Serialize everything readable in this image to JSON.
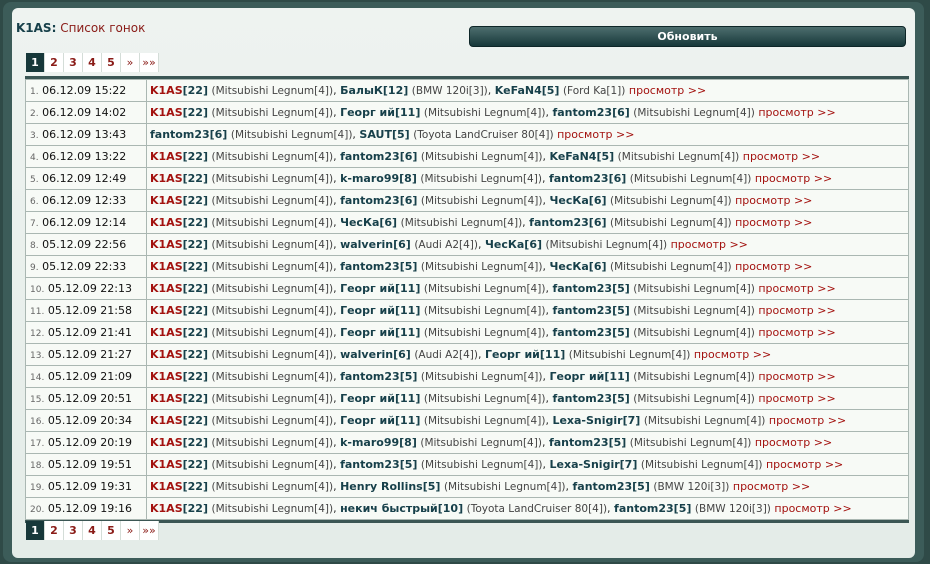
{
  "header": {
    "user": "K1AS",
    "subtitle": "Список гонок",
    "refresh_label": "Обновить"
  },
  "pager": {
    "pages": [
      "1",
      "2",
      "3",
      "4",
      "5"
    ],
    "current": "1",
    "next": "»",
    "last": "»»"
  },
  "races": [
    {
      "n": "1.",
      "date": "06.12.09 15:22",
      "racers": [
        {
          "name": "K1AS",
          "lvl": "[22]",
          "car": "(Mitsubishi Legnum[4])",
          "me": true
        },
        {
          "name": "БалыК",
          "lvl": "[12]",
          "car": "(BMW 120i[3])"
        },
        {
          "name": "KeFaN4",
          "lvl": "[5]",
          "car": "(Ford Ka[1])"
        }
      ]
    },
    {
      "n": "2.",
      "date": "06.12.09 14:02",
      "racers": [
        {
          "name": "K1AS",
          "lvl": "[22]",
          "car": "(Mitsubishi Legnum[4])",
          "me": true
        },
        {
          "name": "Георг ий",
          "lvl": "[11]",
          "car": "(Mitsubishi Legnum[4])"
        },
        {
          "name": "fantom23",
          "lvl": "[6]",
          "car": "(Mitsubishi Legnum[4])"
        }
      ]
    },
    {
      "n": "3.",
      "date": "06.12.09 13:43",
      "racers": [
        {
          "name": "fantom23",
          "lvl": "[6]",
          "car": "(Mitsubishi Legnum[4])"
        },
        {
          "name": "SAUT",
          "lvl": "[5]",
          "car": "(Toyota LandCruiser 80[4])"
        }
      ]
    },
    {
      "n": "4.",
      "date": "06.12.09 13:22",
      "racers": [
        {
          "name": "K1AS",
          "lvl": "[22]",
          "car": "(Mitsubishi Legnum[4])",
          "me": true
        },
        {
          "name": "fantom23",
          "lvl": "[6]",
          "car": "(Mitsubishi Legnum[4])"
        },
        {
          "name": "KeFaN4",
          "lvl": "[5]",
          "car": "(Mitsubishi Legnum[4])"
        }
      ]
    },
    {
      "n": "5.",
      "date": "06.12.09 12:49",
      "racers": [
        {
          "name": "K1AS",
          "lvl": "[22]",
          "car": "(Mitsubishi Legnum[4])",
          "me": true
        },
        {
          "name": "k-maro99",
          "lvl": "[8]",
          "car": "(Mitsubishi Legnum[4])"
        },
        {
          "name": "fantom23",
          "lvl": "[6]",
          "car": "(Mitsubishi Legnum[4])"
        }
      ]
    },
    {
      "n": "6.",
      "date": "06.12.09 12:33",
      "racers": [
        {
          "name": "K1AS",
          "lvl": "[22]",
          "car": "(Mitsubishi Legnum[4])",
          "me": true
        },
        {
          "name": "fantom23",
          "lvl": "[6]",
          "car": "(Mitsubishi Legnum[4])"
        },
        {
          "name": "ЧесКа",
          "lvl": "[6]",
          "car": "(Mitsubishi Legnum[4])"
        }
      ]
    },
    {
      "n": "7.",
      "date": "06.12.09 12:14",
      "racers": [
        {
          "name": "K1AS",
          "lvl": "[22]",
          "car": "(Mitsubishi Legnum[4])",
          "me": true
        },
        {
          "name": "ЧесКа",
          "lvl": "[6]",
          "car": "(Mitsubishi Legnum[4])"
        },
        {
          "name": "fantom23",
          "lvl": "[6]",
          "car": "(Mitsubishi Legnum[4])"
        }
      ]
    },
    {
      "n": "8.",
      "date": "05.12.09 22:56",
      "racers": [
        {
          "name": "K1AS",
          "lvl": "[22]",
          "car": "(Mitsubishi Legnum[4])",
          "me": true
        },
        {
          "name": "walverin",
          "lvl": "[6]",
          "car": "(Audi A2[4])"
        },
        {
          "name": "ЧесКа",
          "lvl": "[6]",
          "car": "(Mitsubishi Legnum[4])"
        }
      ]
    },
    {
      "n": "9.",
      "date": "05.12.09 22:33",
      "racers": [
        {
          "name": "K1AS",
          "lvl": "[22]",
          "car": "(Mitsubishi Legnum[4])",
          "me": true
        },
        {
          "name": "fantom23",
          "lvl": "[5]",
          "car": "(Mitsubishi Legnum[4])"
        },
        {
          "name": "ЧесКа",
          "lvl": "[6]",
          "car": "(Mitsubishi Legnum[4])"
        }
      ]
    },
    {
      "n": "10.",
      "date": "05.12.09 22:13",
      "racers": [
        {
          "name": "K1AS",
          "lvl": "[22]",
          "car": "(Mitsubishi Legnum[4])",
          "me": true
        },
        {
          "name": "Георг ий",
          "lvl": "[11]",
          "car": "(Mitsubishi Legnum[4])"
        },
        {
          "name": "fantom23",
          "lvl": "[5]",
          "car": "(Mitsubishi Legnum[4])"
        }
      ]
    },
    {
      "n": "11.",
      "date": "05.12.09 21:58",
      "racers": [
        {
          "name": "K1AS",
          "lvl": "[22]",
          "car": "(Mitsubishi Legnum[4])",
          "me": true
        },
        {
          "name": "Георг ий",
          "lvl": "[11]",
          "car": "(Mitsubishi Legnum[4])"
        },
        {
          "name": "fantom23",
          "lvl": "[5]",
          "car": "(Mitsubishi Legnum[4])"
        }
      ]
    },
    {
      "n": "12.",
      "date": "05.12.09 21:41",
      "racers": [
        {
          "name": "K1AS",
          "lvl": "[22]",
          "car": "(Mitsubishi Legnum[4])",
          "me": true
        },
        {
          "name": "Георг ий",
          "lvl": "[11]",
          "car": "(Mitsubishi Legnum[4])"
        },
        {
          "name": "fantom23",
          "lvl": "[5]",
          "car": "(Mitsubishi Legnum[4])"
        }
      ]
    },
    {
      "n": "13.",
      "date": "05.12.09 21:27",
      "racers": [
        {
          "name": "K1AS",
          "lvl": "[22]",
          "car": "(Mitsubishi Legnum[4])",
          "me": true
        },
        {
          "name": "walverin",
          "lvl": "[6]",
          "car": "(Audi A2[4])"
        },
        {
          "name": "Георг ий",
          "lvl": "[11]",
          "car": "(Mitsubishi Legnum[4])"
        }
      ]
    },
    {
      "n": "14.",
      "date": "05.12.09 21:09",
      "racers": [
        {
          "name": "K1AS",
          "lvl": "[22]",
          "car": "(Mitsubishi Legnum[4])",
          "me": true
        },
        {
          "name": "fantom23",
          "lvl": "[5]",
          "car": "(Mitsubishi Legnum[4])"
        },
        {
          "name": "Георг ий",
          "lvl": "[11]",
          "car": "(Mitsubishi Legnum[4])"
        }
      ]
    },
    {
      "n": "15.",
      "date": "05.12.09 20:51",
      "racers": [
        {
          "name": "K1AS",
          "lvl": "[22]",
          "car": "(Mitsubishi Legnum[4])",
          "me": true
        },
        {
          "name": "Георг ий",
          "lvl": "[11]",
          "car": "(Mitsubishi Legnum[4])"
        },
        {
          "name": "fantom23",
          "lvl": "[5]",
          "car": "(Mitsubishi Legnum[4])"
        }
      ]
    },
    {
      "n": "16.",
      "date": "05.12.09 20:34",
      "racers": [
        {
          "name": "K1AS",
          "lvl": "[22]",
          "car": "(Mitsubishi Legnum[4])",
          "me": true
        },
        {
          "name": "Георг ий",
          "lvl": "[11]",
          "car": "(Mitsubishi Legnum[4])"
        },
        {
          "name": "Lexa-Snigir",
          "lvl": "[7]",
          "car": "(Mitsubishi Legnum[4])"
        }
      ]
    },
    {
      "n": "17.",
      "date": "05.12.09 20:19",
      "racers": [
        {
          "name": "K1AS",
          "lvl": "[22]",
          "car": "(Mitsubishi Legnum[4])",
          "me": true
        },
        {
          "name": "k-maro99",
          "lvl": "[8]",
          "car": "(Mitsubishi Legnum[4])"
        },
        {
          "name": "fantom23",
          "lvl": "[5]",
          "car": "(Mitsubishi Legnum[4])"
        }
      ]
    },
    {
      "n": "18.",
      "date": "05.12.09 19:51",
      "racers": [
        {
          "name": "K1AS",
          "lvl": "[22]",
          "car": "(Mitsubishi Legnum[4])",
          "me": true
        },
        {
          "name": "fantom23",
          "lvl": "[5]",
          "car": "(Mitsubishi Legnum[4])"
        },
        {
          "name": "Lexa-Snigir",
          "lvl": "[7]",
          "car": "(Mitsubishi Legnum[4])"
        }
      ]
    },
    {
      "n": "19.",
      "date": "05.12.09 19:31",
      "racers": [
        {
          "name": "K1AS",
          "lvl": "[22]",
          "car": "(Mitsubishi Legnum[4])",
          "me": true
        },
        {
          "name": "Henry Rollins",
          "lvl": "[5]",
          "car": "(Mitsubishi Legnum[4])"
        },
        {
          "name": "fantom23",
          "lvl": "[5]",
          "car": "(BMW 120i[3])"
        }
      ]
    },
    {
      "n": "20.",
      "date": "05.12.09 19:16",
      "racers": [
        {
          "name": "K1AS",
          "lvl": "[22]",
          "car": "(Mitsubishi Legnum[4])",
          "me": true
        },
        {
          "name": "некич быстрый",
          "lvl": "[10]",
          "car": "(Toyota LandCruiser 80[4])"
        },
        {
          "name": "fantom23",
          "lvl": "[5]",
          "car": "(BMW 120i[3])"
        }
      ]
    }
  ],
  "view_label": "просмотр >>"
}
